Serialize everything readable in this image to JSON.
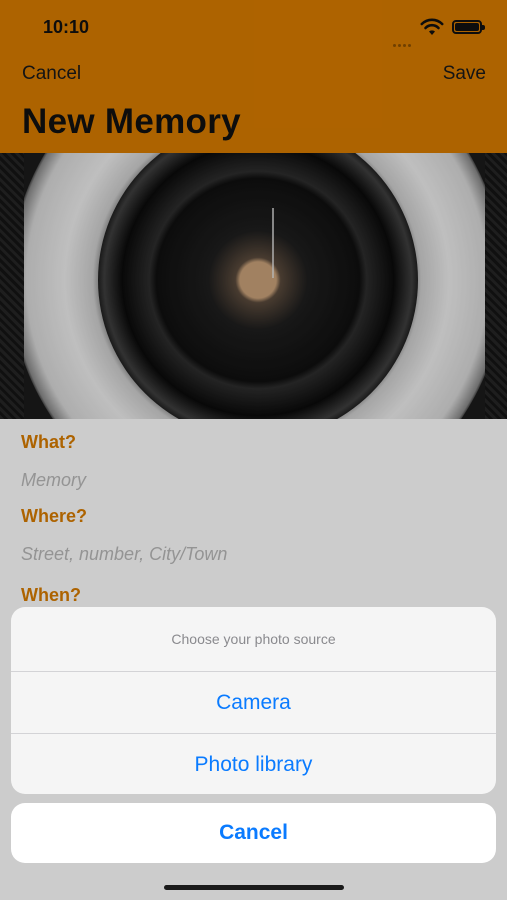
{
  "status_bar": {
    "time": "10:10"
  },
  "nav": {
    "cancel_label": "Cancel",
    "save_label": "Save",
    "title": "New Memory"
  },
  "form": {
    "what_label": "What?",
    "what_placeholder": "Memory",
    "where_label": "Where?",
    "where_placeholder": "Street, number, City/Town",
    "when_label": "When?"
  },
  "action_sheet": {
    "title": "Choose your photo source",
    "options": [
      "Camera",
      "Photo library"
    ],
    "cancel_label": "Cancel"
  },
  "colors": {
    "accent": "#d97c00",
    "action_blue": "#0a7bff"
  },
  "icons": [
    "wifi-icon",
    "battery-icon",
    "cellular-signal-icon"
  ]
}
